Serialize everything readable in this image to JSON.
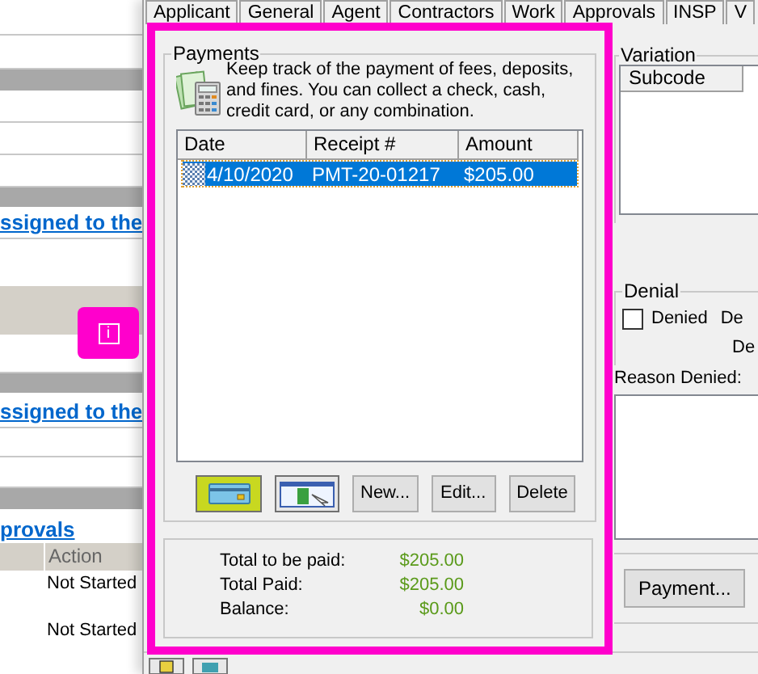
{
  "background_page": {
    "links": [
      "ssigned to the",
      "ssigned to the",
      "provals"
    ],
    "table": {
      "columns": [
        "Action"
      ],
      "rows": [
        "Not Started",
        "Not Started"
      ]
    }
  },
  "callout": {
    "text": "i"
  },
  "dialog": {
    "tabs": [
      "Applicant",
      "General",
      "Agent",
      "Contractors",
      "Work",
      "Approvals",
      "INSP",
      "V"
    ],
    "payments": {
      "title": "Payments",
      "description": "Keep track of the payment of fees, deposits, and fines. You can collect a check, cash, credit card, or any combination.",
      "columns": [
        "Date",
        "Receipt #",
        "Amount"
      ],
      "rows": [
        {
          "date": "4/10/2020",
          "receipt": "PMT-20-01217",
          "amount": "$205.00",
          "selected": true
        }
      ],
      "buttons": [
        {
          "kind": "card"
        },
        {
          "kind": "cash"
        },
        {
          "kind": "text",
          "label": "New..."
        },
        {
          "kind": "text",
          "label": "Edit..."
        },
        {
          "kind": "text",
          "label": "Delete"
        }
      ]
    },
    "totals": [
      {
        "label": "Total to be paid:",
        "value": "$205.00"
      },
      {
        "label": "Total Paid:",
        "value": "$205.00"
      },
      {
        "label": "Balance:",
        "value": "$0.00"
      }
    ],
    "variation": {
      "title": "Variation",
      "columns": [
        "Subcode"
      ]
    },
    "denial": {
      "title": "Denial",
      "denied": {
        "label": "Denied",
        "checked": false
      },
      "side_label_1": "De",
      "side_label_2": "De",
      "reason_label": "Reason Denied:"
    },
    "buttons": [
      "Payment..."
    ]
  }
}
